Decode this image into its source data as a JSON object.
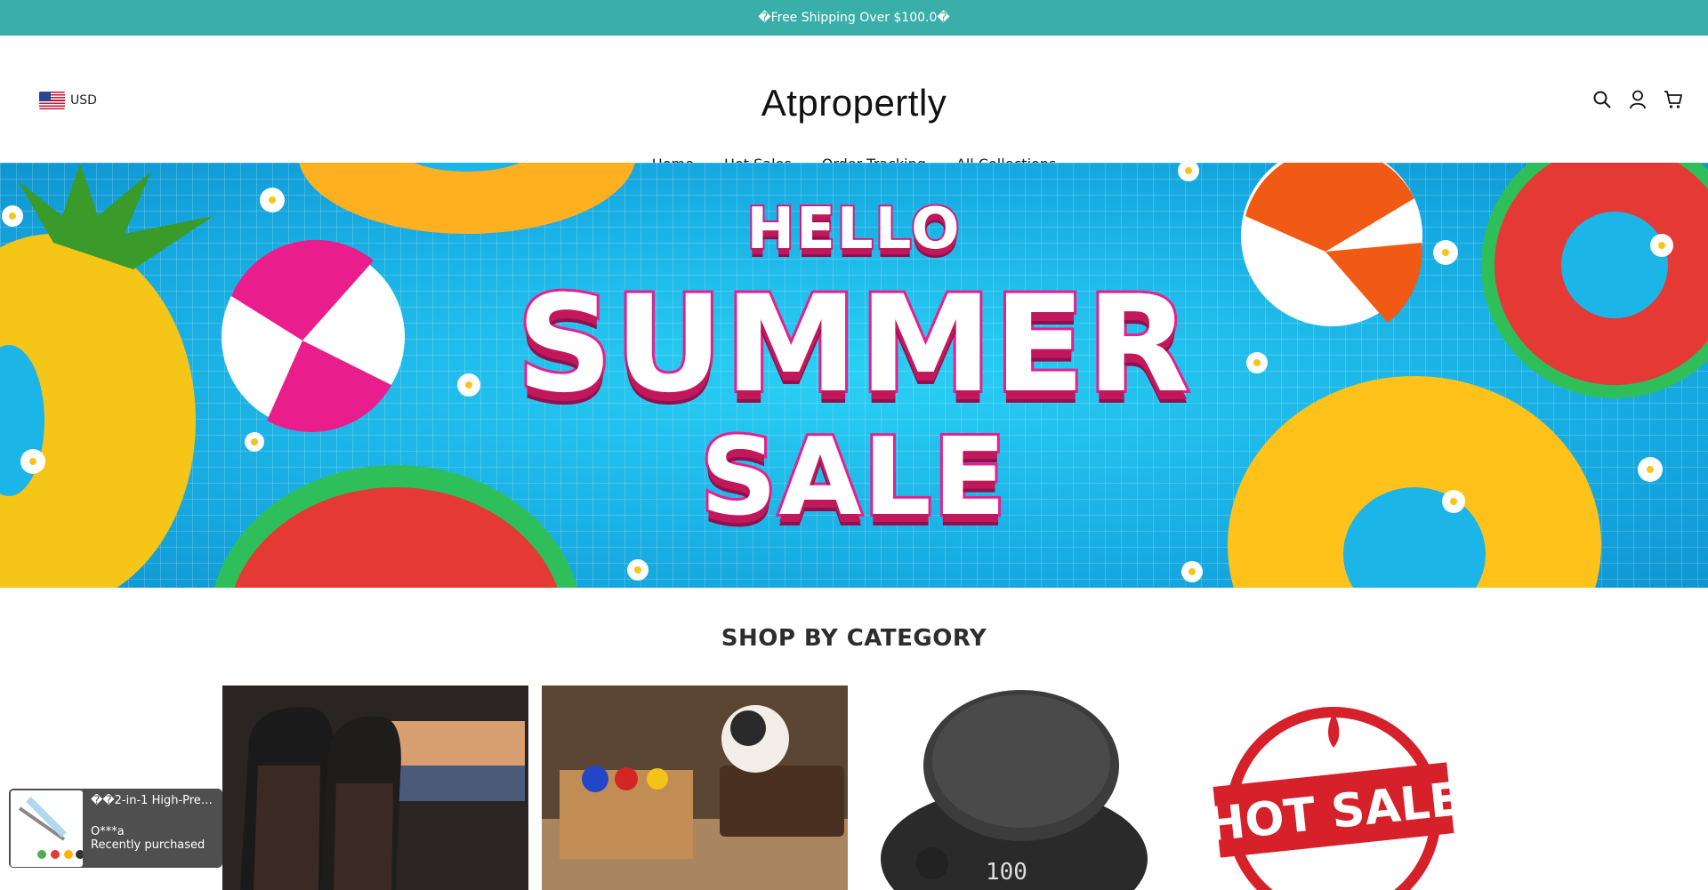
{
  "announcement": "�Free Shipping Over $100.0�",
  "header": {
    "currency": "USD",
    "brand": "Atpropertly"
  },
  "nav": {
    "items": [
      "Home",
      "Hot Sales",
      "Order Tracking",
      "All Collections"
    ]
  },
  "hero": {
    "line1": "HELLO",
    "line2": "SUMMER",
    "line3": "SALE"
  },
  "categories_section": {
    "title": "SHOP BY CATEGORY"
  },
  "category_badge": {
    "text": "HOT SALE"
  },
  "purchase_popup": {
    "product": "��2-in-1 High-Press...",
    "buyer": "O***a",
    "status": "Recently purchased"
  },
  "colors": {
    "announcement_bg": "#3aafa9",
    "hero_pink": "#e91e8c",
    "pool_blue": "#1cb5e8"
  },
  "icons": [
    "search-icon",
    "account-icon",
    "cart-icon"
  ]
}
